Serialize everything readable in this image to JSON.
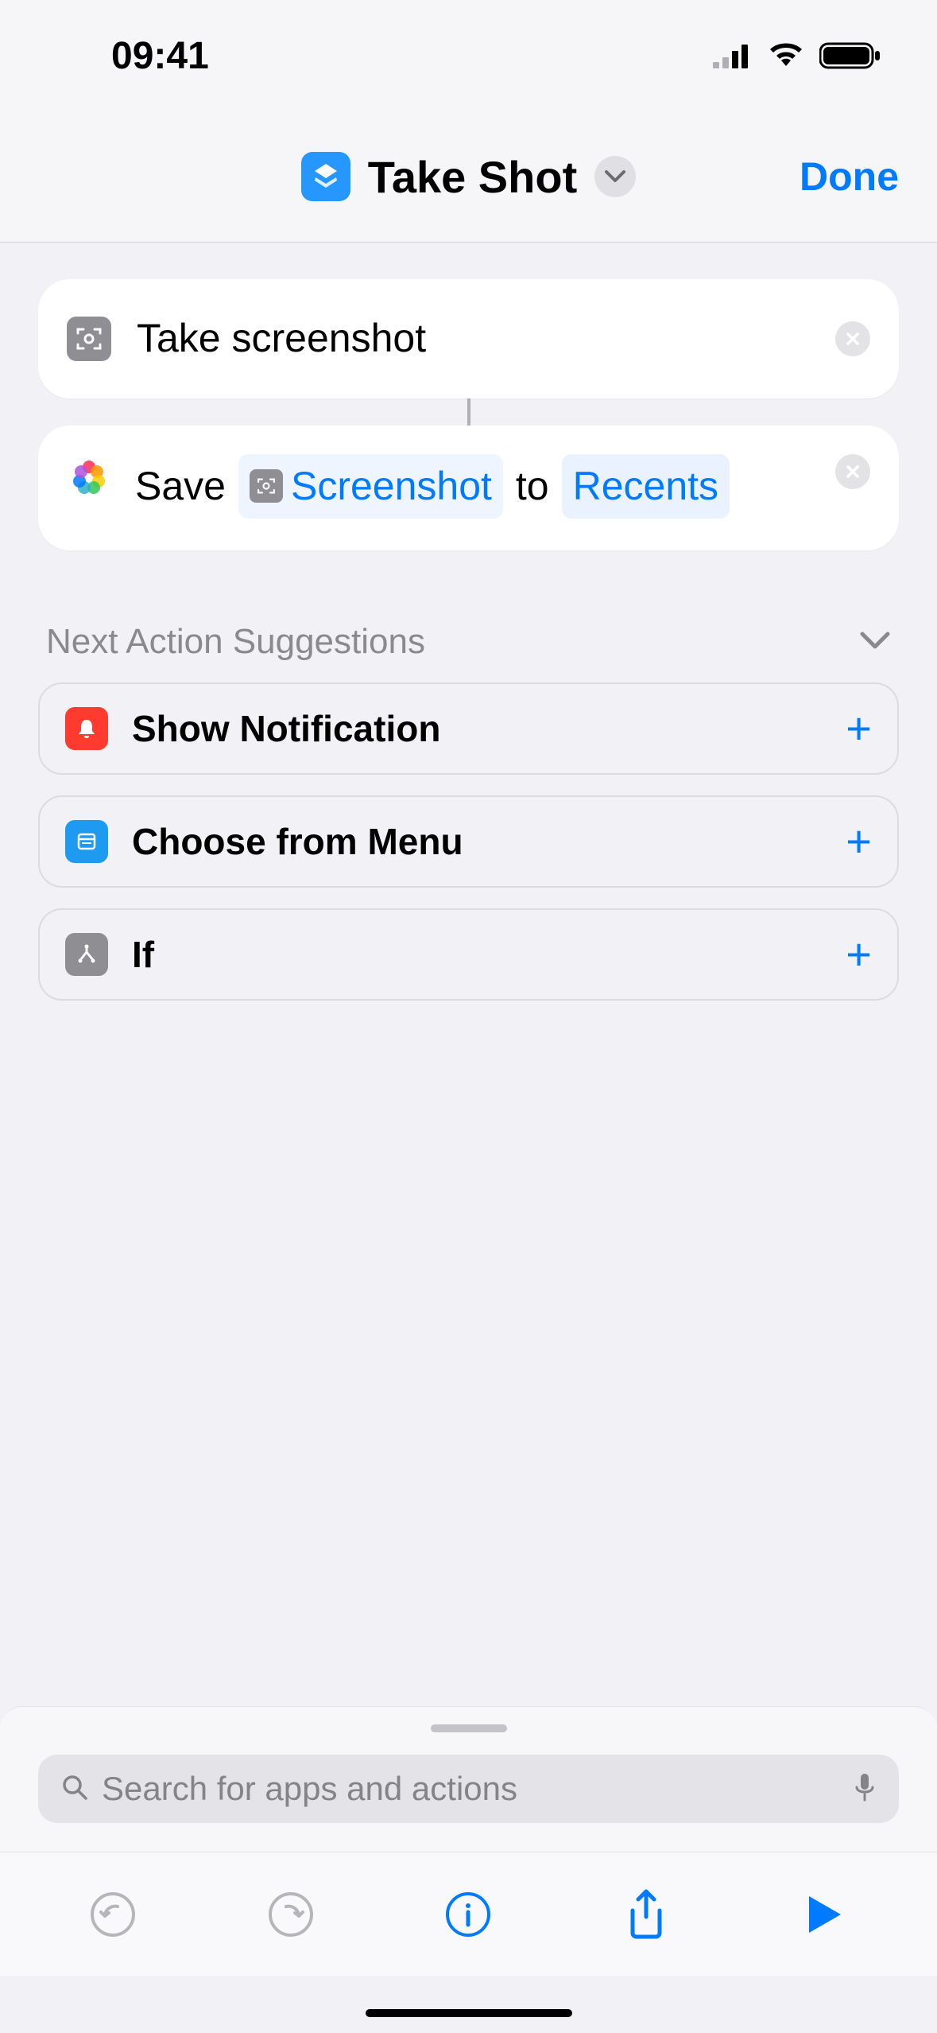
{
  "status": {
    "time": "09:41"
  },
  "header": {
    "title": "Take Shot",
    "done": "Done"
  },
  "actions": {
    "screenshot": {
      "label": "Take screenshot"
    },
    "save": {
      "verb": "Save",
      "variable": "Screenshot",
      "to": "to",
      "dest": "Recents"
    }
  },
  "suggestions": {
    "title": "Next Action Suggestions",
    "items": [
      {
        "label": "Show Notification",
        "iconColor": "red",
        "icon": "bell"
      },
      {
        "label": "Choose from Menu",
        "iconColor": "blue",
        "icon": "menu"
      },
      {
        "label": "If",
        "iconColor": "gray",
        "icon": "branch"
      }
    ]
  },
  "search": {
    "placeholder": "Search for apps and actions"
  }
}
